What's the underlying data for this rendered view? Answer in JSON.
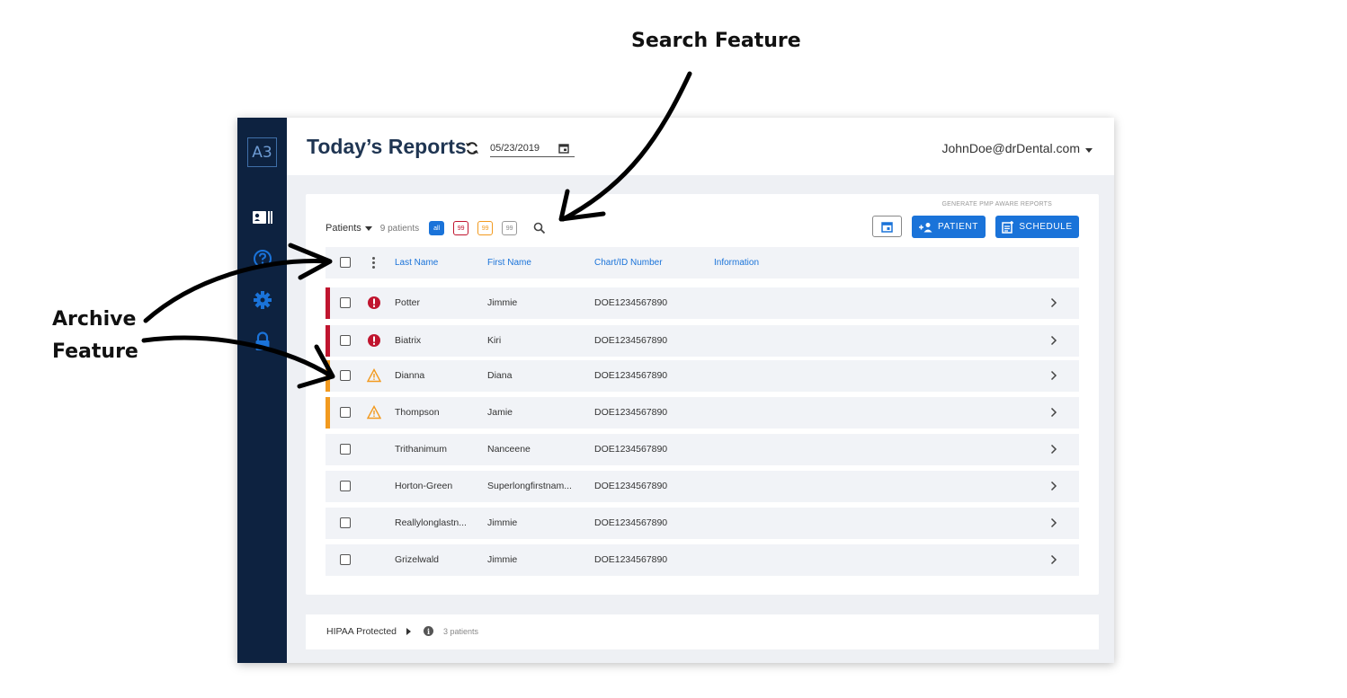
{
  "annotations": {
    "search": "Search Feature",
    "archive_line1": "Archive",
    "archive_line2": "Feature"
  },
  "sidebar": {
    "logo": "A3",
    "items": [
      {
        "icon": "id-card-icon"
      },
      {
        "icon": "help-circle-icon"
      },
      {
        "icon": "gear-icon"
      },
      {
        "icon": "lock-icon"
      }
    ]
  },
  "header": {
    "title": "Today’s Reports",
    "date": "05/23/2019",
    "user": "JohnDoe@drDental.com"
  },
  "toolbar": {
    "patients_label": "Patients",
    "patient_count": "9 patients",
    "filters": [
      {
        "label": "all",
        "color": "#1a73d9"
      },
      {
        "label": "99",
        "color": "#c0152f"
      },
      {
        "label": "99",
        "color": "#f29a1f"
      },
      {
        "label": "99",
        "color": "#999999"
      }
    ],
    "generate_label": "GENERATE PMP AWARE REPORTS",
    "patient_button": "PATIENT",
    "schedule_button": "SCHEDULE"
  },
  "table": {
    "columns": [
      "Last Name",
      "First Name",
      "Chart/ID Number",
      "Information"
    ],
    "rows": [
      {
        "last": "Potter",
        "first": "Jimmie",
        "chart": "DOE1234567890",
        "status": "error",
        "accent": "#c0152f"
      },
      {
        "last": "Biatrix",
        "first": "Kiri",
        "chart": "DOE1234567890",
        "status": "error",
        "accent": "#c0152f"
      },
      {
        "last": "Dianna",
        "first": "Diana",
        "chart": "DOE1234567890",
        "status": "warning",
        "accent": "#f29a1f"
      },
      {
        "last": "Thompson",
        "first": "Jamie",
        "chart": "DOE1234567890",
        "status": "warning",
        "accent": "#f29a1f"
      },
      {
        "last": "Trithanimum",
        "first": "Nanceene",
        "chart": "DOE1234567890",
        "status": "none",
        "accent": ""
      },
      {
        "last": "Horton-Green",
        "first": "Superlongfirstnam...",
        "chart": "DOE1234567890",
        "status": "none",
        "accent": ""
      },
      {
        "last": "Reallylonglastn...",
        "first": "Jimmie",
        "chart": "DOE1234567890",
        "status": "none",
        "accent": ""
      },
      {
        "last": "Grizelwald",
        "first": "Jimmie",
        "chart": "DOE1234567890",
        "status": "none",
        "accent": ""
      }
    ]
  },
  "footer": {
    "label": "HIPAA Protected",
    "count": "3 patients"
  },
  "colors": {
    "sidebar": "#0d2240",
    "primary": "#1a73d9",
    "error": "#c0152f",
    "warning": "#f29a1f"
  }
}
